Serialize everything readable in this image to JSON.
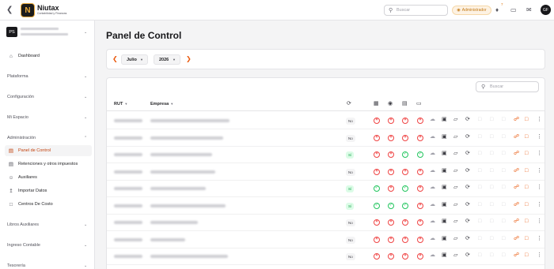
{
  "brand": {
    "name": "Niutax",
    "subtitle": "Contabilidad y Finanzas",
    "logo_glyph": "N"
  },
  "topbar": {
    "search_placeholder": "Buscar",
    "role_badge": "Administrador",
    "notification_count": "7",
    "user_initials": "GF",
    "accent_color": "#ea580c"
  },
  "workspace": {
    "initials": "PS"
  },
  "sidebar": {
    "dashboard": "Dashboard",
    "plataforma": "Plataforma",
    "configuracion": "Configuración",
    "mi_espacio": "Mi Espacio",
    "administracion": "Administración",
    "admin_items": [
      {
        "label": "Panel de Control",
        "icon": "control-panel-icon",
        "active": true
      },
      {
        "label": "Retenciones y otros impuestos",
        "icon": "document-icon",
        "active": false
      },
      {
        "label": "Auxiliares",
        "icon": "users-icon",
        "active": false
      },
      {
        "label": "Importar Datos",
        "icon": "upload-icon",
        "active": false
      },
      {
        "label": "Centros De Costo",
        "icon": "file-icon",
        "active": false
      }
    ],
    "libros_auxiliares": "Libros Auxiliares",
    "ingreso_contable": "Ingreso Contable",
    "tesoreria": "Tesorería"
  },
  "main": {
    "title": "Panel de Control",
    "month": "Julio",
    "year": "2026",
    "table_search_placeholder": "Buscar",
    "columns": {
      "rut": "RUT",
      "empresa": "Empresa"
    }
  },
  "rows": [
    {
      "flag": "No",
      "s": [
        "x",
        "x",
        "x",
        "x"
      ]
    },
    {
      "flag": "No",
      "s": [
        "x",
        "x",
        "x",
        "x"
      ]
    },
    {
      "flag": "Sí",
      "s": [
        "x",
        "x",
        "ok",
        "ok"
      ]
    },
    {
      "flag": "No",
      "s": [
        "x",
        "x",
        "x",
        "x"
      ]
    },
    {
      "flag": "Sí",
      "s": [
        "ok",
        "x",
        "ok",
        "x"
      ]
    },
    {
      "flag": "Sí",
      "s": [
        "ok",
        "ok",
        "ok",
        "x"
      ]
    },
    {
      "flag": "No",
      "s": [
        "x",
        "x",
        "x",
        "x"
      ]
    },
    {
      "flag": "No",
      "s": [
        "x",
        "x",
        "x",
        "x"
      ]
    },
    {
      "flag": "No",
      "s": [
        "x",
        "x",
        "x",
        "x"
      ]
    }
  ]
}
